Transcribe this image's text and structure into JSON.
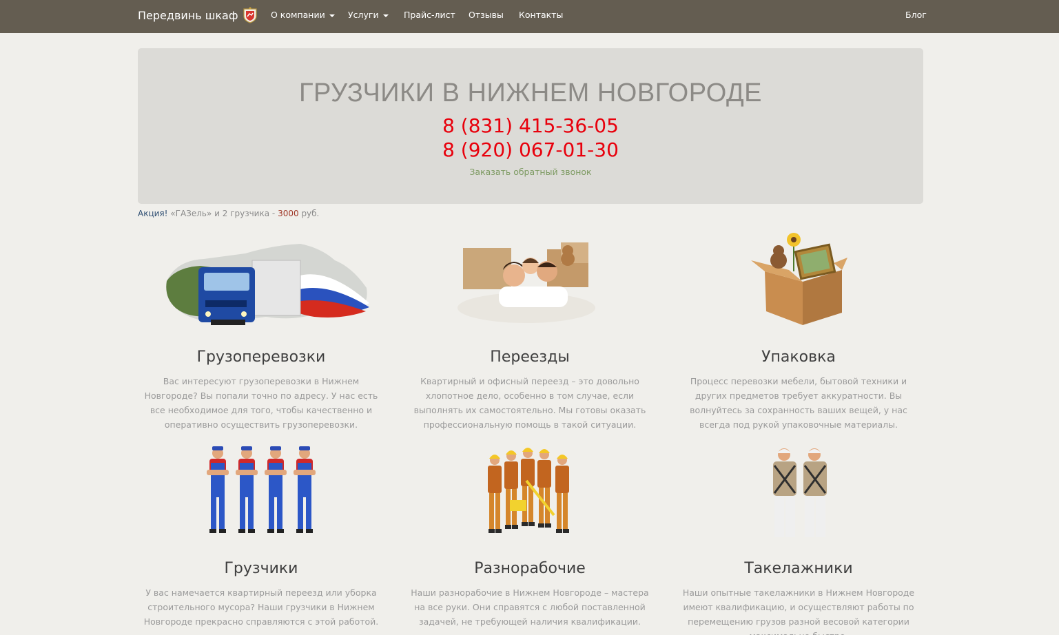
{
  "nav": {
    "brand": "Передвинь шкаф",
    "items": [
      {
        "label": "О компании",
        "dropdown": true
      },
      {
        "label": "Услуги",
        "dropdown": true
      },
      {
        "label": "Прайс-лист",
        "dropdown": false
      },
      {
        "label": "Отзывы",
        "dropdown": false
      },
      {
        "label": "Контакты",
        "dropdown": false
      }
    ],
    "blog": "Блог"
  },
  "hero": {
    "title": "ГРУЗЧИКИ В НИЖНЕМ НОВГОРОДЕ",
    "phone1": "8 (831) 415-36-05",
    "phone2": "8 (920) 067-01-30",
    "callback": "Заказать обратный звонок"
  },
  "promo": {
    "label": "Акция!",
    "text": "«ГАЗель» и 2 грузчика -",
    "price": "3000",
    "currency": "руб."
  },
  "services": [
    {
      "title": "Грузоперевозки",
      "text": "Вас интересуют грузоперевозки в Нижнем Новгороде? Вы попали точно по адресу. У нас есть все необходимое для того, чтобы качественно и оперативно осуществить грузоперевозки."
    },
    {
      "title": "Переезды",
      "text": "Квартирный и офисный переезд – это довольно хлопотное дело, особенно в том случае, если выполнять их самостоятельно. Мы готовы оказать профессиональную помощь в такой ситуации."
    },
    {
      "title": "Упаковка",
      "text": "Процесс перевозки мебели, бытовой техники и других предметов требует аккуратности. Вы волнуйтесь за сохранность ваших вещей, у нас всегда под рукой упаковочные материалы."
    },
    {
      "title": "Грузчики",
      "text": "У вас намечается квартирный переезд или уборка строительного мусора? Наши грузчики в Нижнем Новгороде прекрасно справляются с этой работой."
    },
    {
      "title": "Разнорабочие",
      "text": "Наши разнорабочие в Нижнем Новгороде – мастера на все руки. Они справятся с любой поставленной задачей, не требующей наличия квалификации."
    },
    {
      "title": "Такелажники",
      "text": "Наши опытные такелажники в Нижнем Новгороде имеют квалификацию, и осуществляют работы по перемещению грузов разной весовой категории максимально быстро."
    }
  ]
}
